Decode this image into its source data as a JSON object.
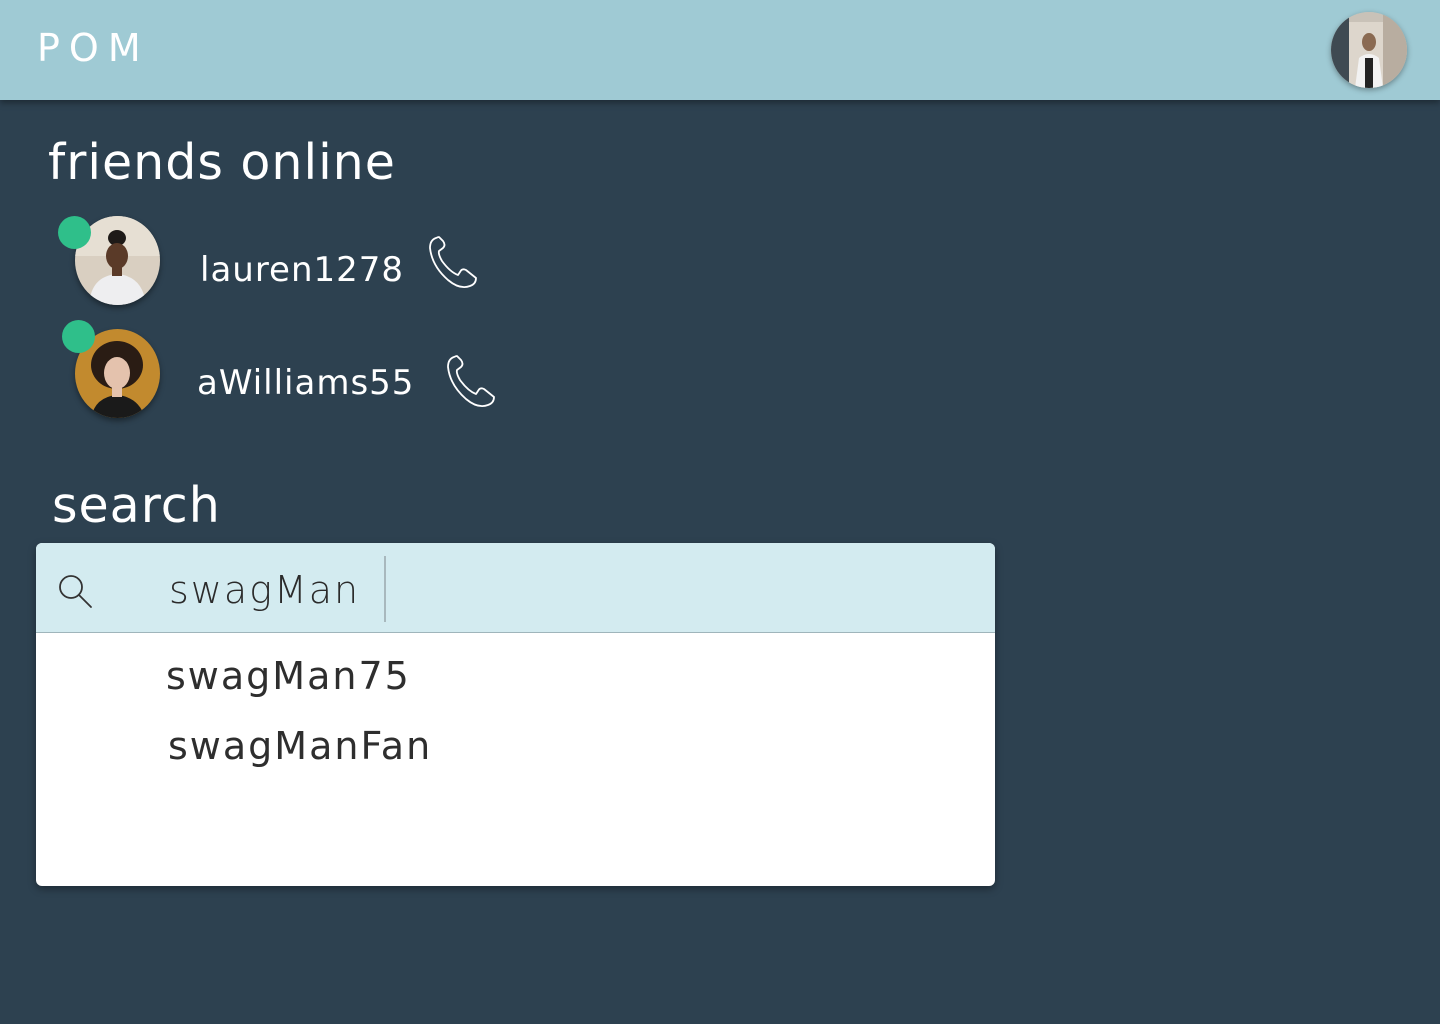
{
  "header": {
    "logo": "POM",
    "profile_avatar_icon": "user-avatar-icon"
  },
  "friends": {
    "title": "friends online",
    "items": [
      {
        "username": "lauren1278",
        "status": "online",
        "call_icon": "phone-icon"
      },
      {
        "username": "aWilliams55",
        "status": "online",
        "call_icon": "phone-icon"
      }
    ]
  },
  "search": {
    "title": "search",
    "input_value": "swagMan",
    "search_icon": "search-icon",
    "suggestions": [
      "swagMan75",
      "swagManFan"
    ]
  },
  "colors": {
    "background": "#2d4150",
    "header": "#9fcad4",
    "search_bar": "#d3ebf0",
    "online": "#2fbf8a"
  }
}
